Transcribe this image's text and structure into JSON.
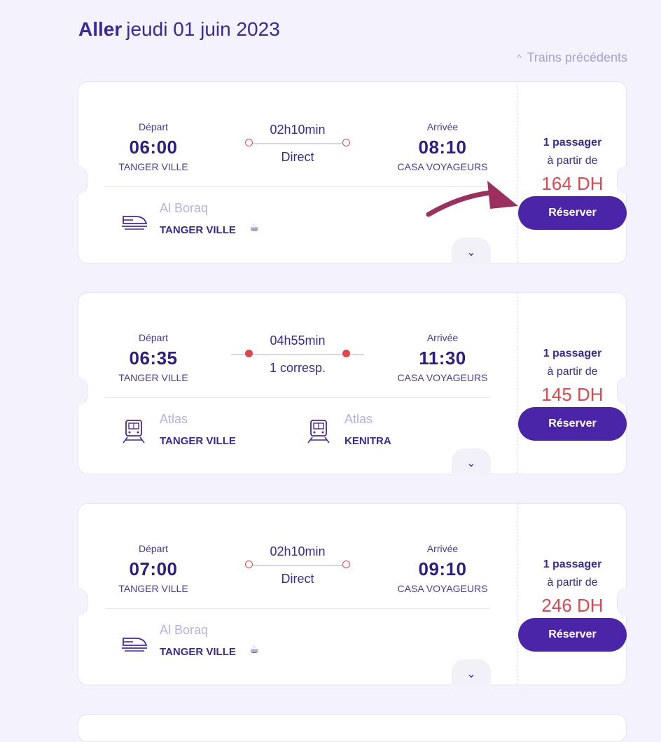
{
  "header": {
    "direction": "Aller",
    "date": "jeudi 01 juin 2023",
    "prev_trains": "Trains précédents"
  },
  "labels": {
    "depart": "Départ",
    "arrivee": "Arrivée",
    "passengers": "1 passager",
    "from": "à partir de",
    "book": "Réserver"
  },
  "trips": [
    {
      "dep_time": "06:00",
      "dep_station": "TANGER VILLE",
      "arr_time": "08:10",
      "arr_station": "CASA VOYAGEURS",
      "duration": "02h10min",
      "type": "Direct",
      "price": "164 DH",
      "segments": [
        {
          "train": "Al Boraq",
          "station": "TANGER VILLE",
          "icon": "high-speed-train-icon",
          "cup_icon": "coffee-cup-icon"
        }
      ]
    },
    {
      "dep_time": "06:35",
      "dep_station": "TANGER VILLE",
      "arr_time": "11:30",
      "arr_station": "CASA VOYAGEURS",
      "duration": "04h55min",
      "type": "1 corresp.",
      "price": "145 DH",
      "segments": [
        {
          "train": "Atlas",
          "station": "TANGER VILLE",
          "icon": "train-icon"
        },
        {
          "train": "Atlas",
          "station": "KENITRA",
          "icon": "train-icon"
        }
      ]
    },
    {
      "dep_time": "07:00",
      "dep_station": "TANGER VILLE",
      "arr_time": "09:10",
      "arr_station": "CASA VOYAGEURS",
      "duration": "02h10min",
      "type": "Direct",
      "price": "246 DH",
      "segments": [
        {
          "train": "Al Boraq",
          "station": "TANGER VILLE",
          "icon": "high-speed-train-icon",
          "cup_icon": "coffee-cup-icon"
        }
      ]
    }
  ],
  "colors": {
    "accent": "#4b25a8",
    "price": "#e0474c",
    "annotation_arrow": "#9b2f5e"
  }
}
